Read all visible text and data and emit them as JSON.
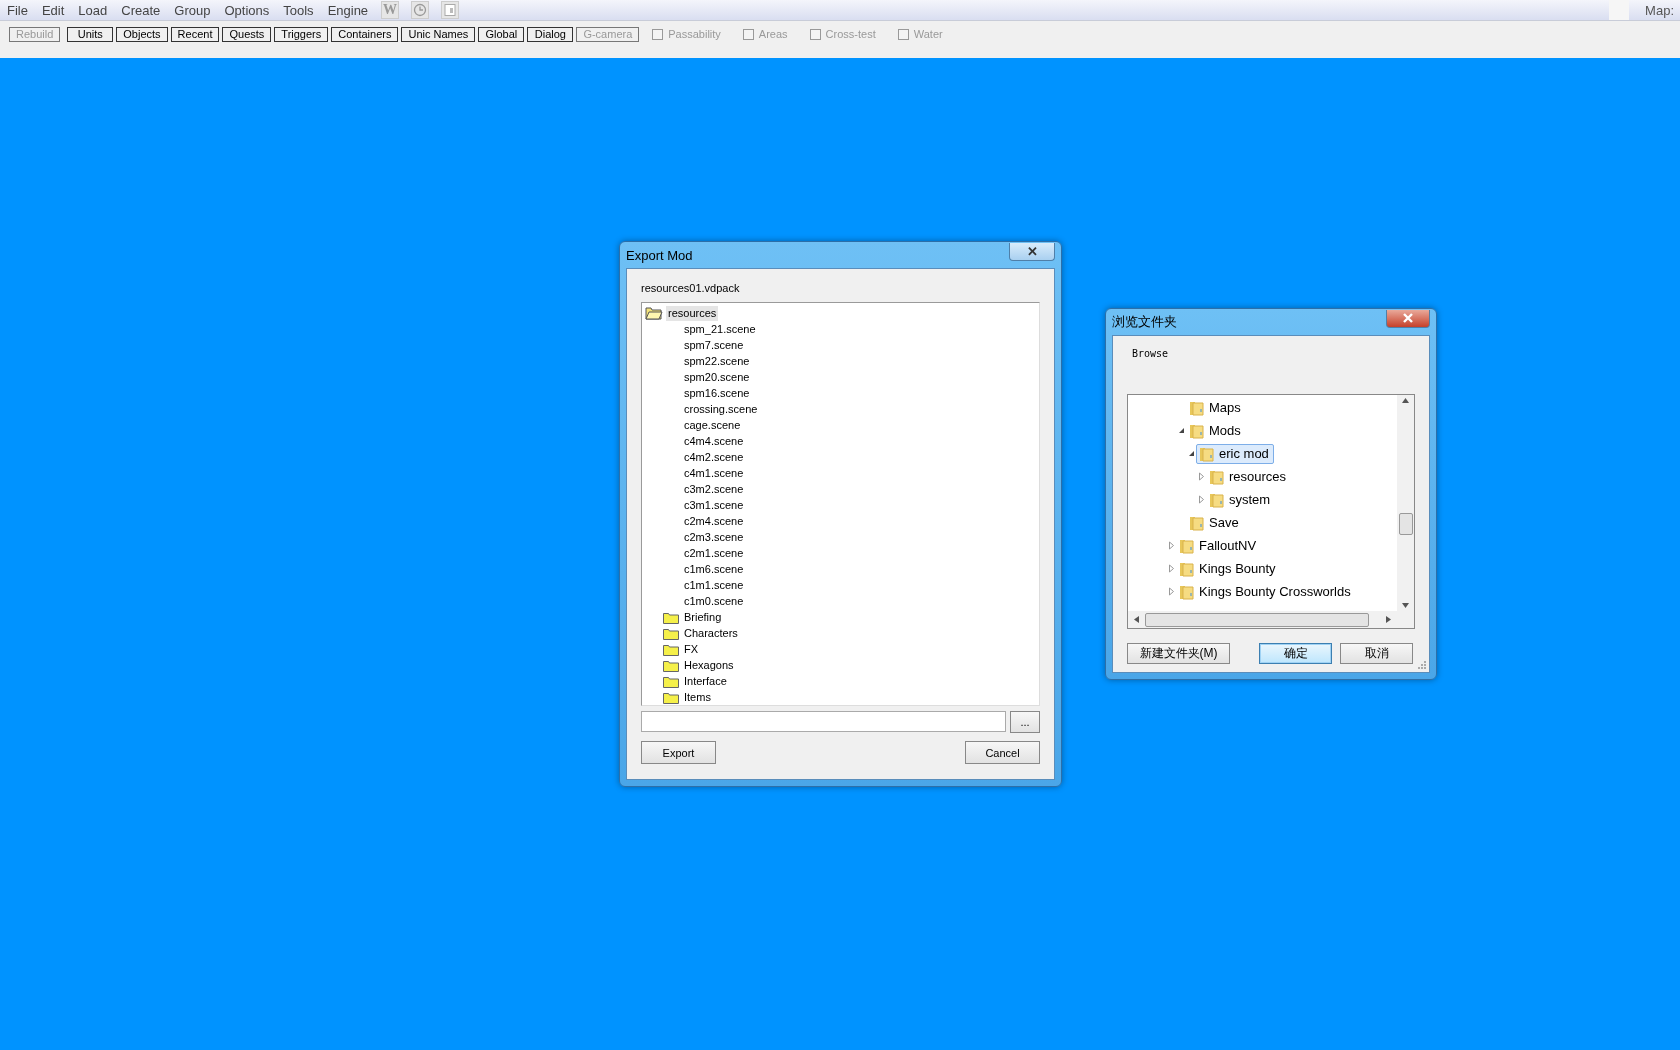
{
  "menu": {
    "items": [
      "File",
      "Edit",
      "Load",
      "Create",
      "Group",
      "Options",
      "Tools",
      "Engine"
    ],
    "icon_buttons": [
      {
        "kind": "letter",
        "label": "W"
      },
      {
        "kind": "clock"
      },
      {
        "kind": "window"
      }
    ],
    "map_label": "Map:"
  },
  "toolbar": {
    "buttons": [
      {
        "label": "Rebuild",
        "disabled": true
      },
      {
        "label": "Units",
        "disabled": false
      },
      {
        "label": "Objects",
        "disabled": false
      },
      {
        "label": "Recent",
        "disabled": false
      },
      {
        "label": "Quests",
        "disabled": false
      },
      {
        "label": "Triggers",
        "disabled": false
      },
      {
        "label": "Containers",
        "disabled": false
      },
      {
        "label": "Unic Names",
        "disabled": false
      },
      {
        "label": "Global",
        "disabled": false
      },
      {
        "label": "Dialog",
        "disabled": false
      },
      {
        "label": "G-camera",
        "disabled": true
      }
    ],
    "checkboxes": [
      {
        "label": "Passability",
        "checked": false,
        "disabled": true
      },
      {
        "label": "Areas",
        "checked": false,
        "disabled": true
      },
      {
        "label": "Cross-test",
        "checked": false,
        "disabled": true
      },
      {
        "label": "Water",
        "checked": false,
        "disabled": true
      }
    ]
  },
  "export_dialog": {
    "title": "Export Mod",
    "close": "✕",
    "file_label": "resources01.vdpack",
    "tree": {
      "label": "resources",
      "selected": true,
      "children": [
        {
          "kind": "file",
          "label": "spm_21.scene"
        },
        {
          "kind": "file",
          "label": "spm7.scene"
        },
        {
          "kind": "file",
          "label": "spm22.scene"
        },
        {
          "kind": "file",
          "label": "spm20.scene"
        },
        {
          "kind": "file",
          "label": "spm16.scene"
        },
        {
          "kind": "file",
          "label": "crossing.scene"
        },
        {
          "kind": "file",
          "label": "cage.scene"
        },
        {
          "kind": "file",
          "label": "c4m4.scene"
        },
        {
          "kind": "file",
          "label": "c4m2.scene"
        },
        {
          "kind": "file",
          "label": "c4m1.scene"
        },
        {
          "kind": "file",
          "label": "c3m2.scene"
        },
        {
          "kind": "file",
          "label": "c3m1.scene"
        },
        {
          "kind": "file",
          "label": "c2m4.scene"
        },
        {
          "kind": "file",
          "label": "c2m3.scene"
        },
        {
          "kind": "file",
          "label": "c2m1.scene"
        },
        {
          "kind": "file",
          "label": "c1m6.scene"
        },
        {
          "kind": "file",
          "label": "c1m1.scene"
        },
        {
          "kind": "file",
          "label": "c1m0.scene"
        },
        {
          "kind": "folder",
          "label": "Briefing"
        },
        {
          "kind": "folder",
          "label": "Characters"
        },
        {
          "kind": "folder",
          "label": "FX"
        },
        {
          "kind": "folder",
          "label": "Hexagons"
        },
        {
          "kind": "folder",
          "label": "Interface"
        },
        {
          "kind": "folder",
          "label": "Items"
        }
      ]
    },
    "browse_button": "...",
    "buttons": [
      "Export",
      "Cancel"
    ]
  },
  "browse_dialog": {
    "title": "浏览文件夹",
    "prompt": "Browse",
    "tree": [
      {
        "children": [
          {
            "label": "Maps",
            "selected": false
          },
          {
            "label": "Mods",
            "selected": false,
            "expanded": true,
            "children": [
              {
                "label": "eric mod",
                "selected": true,
                "expanded": true,
                "children": [
                  {
                    "label": "resources",
                    "selected": false,
                    "expanded": false
                  },
                  {
                    "label": "system",
                    "selected": false,
                    "expanded": false
                  }
                ]
              }
            ]
          },
          {
            "label": "Save",
            "selected": false
          }
        ]
      },
      {
        "label": "FalloutNV",
        "selected": false,
        "expanded": false
      },
      {
        "label": "Kings Bounty",
        "selected": false,
        "expanded": false
      },
      {
        "label": "Kings Bounty Crossworlds",
        "selected": false,
        "expanded": false
      }
    ],
    "buttons": [
      {
        "label": "新建文件夹(M)",
        "default": false
      },
      {
        "label": "确定",
        "default": true
      },
      {
        "label": "取消",
        "default": false
      }
    ]
  }
}
